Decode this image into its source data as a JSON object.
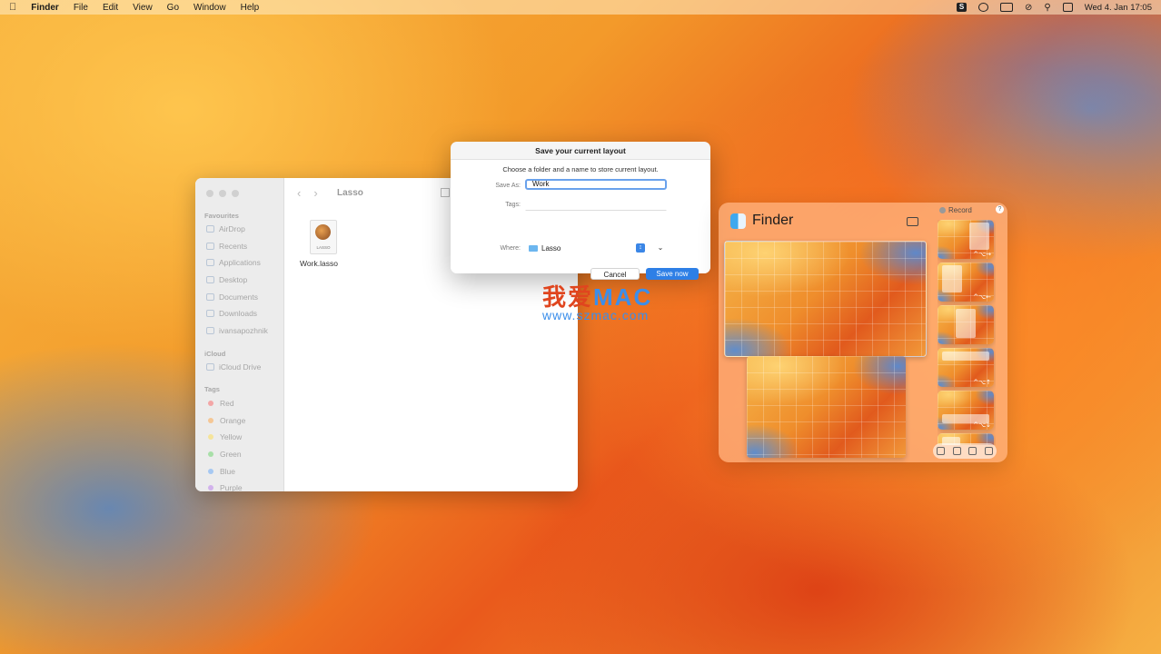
{
  "menubar": {
    "app_name": "Finder",
    "menus": [
      "File",
      "Edit",
      "View",
      "Go",
      "Window",
      "Help"
    ],
    "clock": "Wed 4. Jan  17:05",
    "status_icons": [
      "skype-icon",
      "chat-icon",
      "battery-icon",
      "wifi-off-icon",
      "search-icon",
      "control-center-icon"
    ]
  },
  "finder": {
    "title": "Lasso",
    "sidebar": {
      "favourites_header": "Favourites",
      "favourites": [
        "AirDrop",
        "Recents",
        "Applications",
        "Desktop",
        "Documents",
        "Downloads",
        "ivansapozhnik"
      ],
      "icloud_header": "iCloud",
      "icloud": [
        "iCloud Drive"
      ],
      "tags_header": "Tags",
      "tags": [
        {
          "label": "Red",
          "color": "#f3a6a6"
        },
        {
          "label": "Orange",
          "color": "#f5c795"
        },
        {
          "label": "Yellow",
          "color": "#f5e49a"
        },
        {
          "label": "Green",
          "color": "#a8dfa8"
        },
        {
          "label": "Blue",
          "color": "#a6c8f2"
        },
        {
          "label": "Purple",
          "color": "#d2b2ec"
        }
      ]
    },
    "file": {
      "name": "Work.lasso",
      "doc_label": "LASSO"
    }
  },
  "dialog": {
    "title": "Save your current layout",
    "description": "Choose a folder and a name to store current layout.",
    "save_as_label": "Save As:",
    "save_as_value": "Work",
    "tags_label": "Tags:",
    "tags_value": "",
    "where_label": "Where:",
    "where_value": "Lasso",
    "cancel_label": "Cancel",
    "save_label": "Save now"
  },
  "watermark": {
    "cn": "我爱",
    "mac": "MAC",
    "url": "www.szmac.com"
  },
  "lasso_panel": {
    "app_title": "Finder",
    "record_label": "Record",
    "help_label": "?",
    "shortcuts": [
      "^⌥→",
      "^⌥←",
      "",
      "^⌥↑",
      "^⌥↓",
      ""
    ]
  }
}
